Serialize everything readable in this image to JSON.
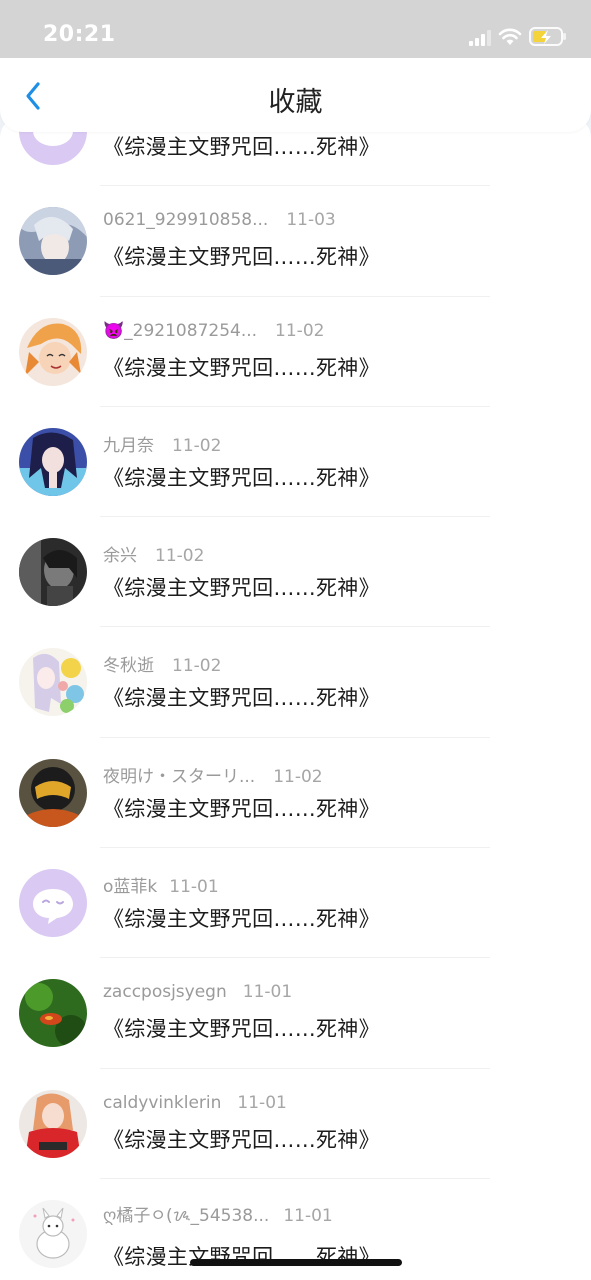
{
  "status": {
    "time": "20:21"
  },
  "nav": {
    "title": "收藏"
  },
  "items": [
    {
      "name": "",
      "date": "",
      "message": "《综漫主文野咒回……死神》"
    },
    {
      "name": "0621_929910858...",
      "date": "11-03",
      "message": "《综漫主文野咒回……死神》"
    },
    {
      "name": "👿_2921087254...",
      "date": "11-02",
      "message": "《综漫主文野咒回……死神》"
    },
    {
      "name": "九月奈",
      "date": "11-02",
      "message": "《综漫主文野咒回……死神》"
    },
    {
      "name": "余兴",
      "date": "11-02",
      "message": "《综漫主文野咒回……死神》"
    },
    {
      "name": "冬秋逝",
      "date": "11-02",
      "message": "《综漫主文野咒回……死神》"
    },
    {
      "name": "夜明け・スターリ...",
      "date": "11-02",
      "message": "《综漫主文野咒回……死神》"
    },
    {
      "name": "o蓝菲k",
      "date": "11-01",
      "message": "《综漫主文野咒回……死神》"
    },
    {
      "name": "zaccposjsyegn",
      "date": "11-01",
      "message": "《综漫主文野咒回……死神》"
    },
    {
      "name": "caldyvinklerin",
      "date": "11-01",
      "message": "《综漫主文野咒回……死神》"
    },
    {
      "name": "ღ橘子ㅇ(ᝰ_54538...",
      "date": "11-01",
      "message": "《综漫主文野咒回……死神》"
    }
  ],
  "colors": {
    "accent": "#1f8fe6",
    "avatar_default": "#d9c9f3"
  }
}
